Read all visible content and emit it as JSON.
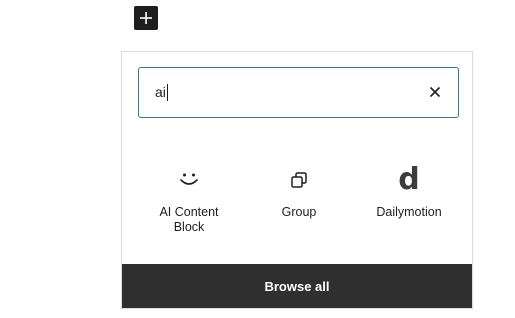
{
  "search": {
    "value": "ai",
    "placeholder": ""
  },
  "icons": {
    "toggle": "plus-icon",
    "clear": "close-icon"
  },
  "results": [
    {
      "label": "AI Content Block",
      "icon": "smile-icon"
    },
    {
      "label": "Group",
      "icon": "group-icon"
    },
    {
      "label": "Dailymotion",
      "icon": "dailymotion-icon",
      "glyph": "d"
    }
  ],
  "footer": {
    "browse_label": "Browse all"
  },
  "colors": {
    "focus_border": "#2f7f88",
    "footer_bg": "#2f2f2f",
    "toggle_bg": "#1e1e1e"
  }
}
